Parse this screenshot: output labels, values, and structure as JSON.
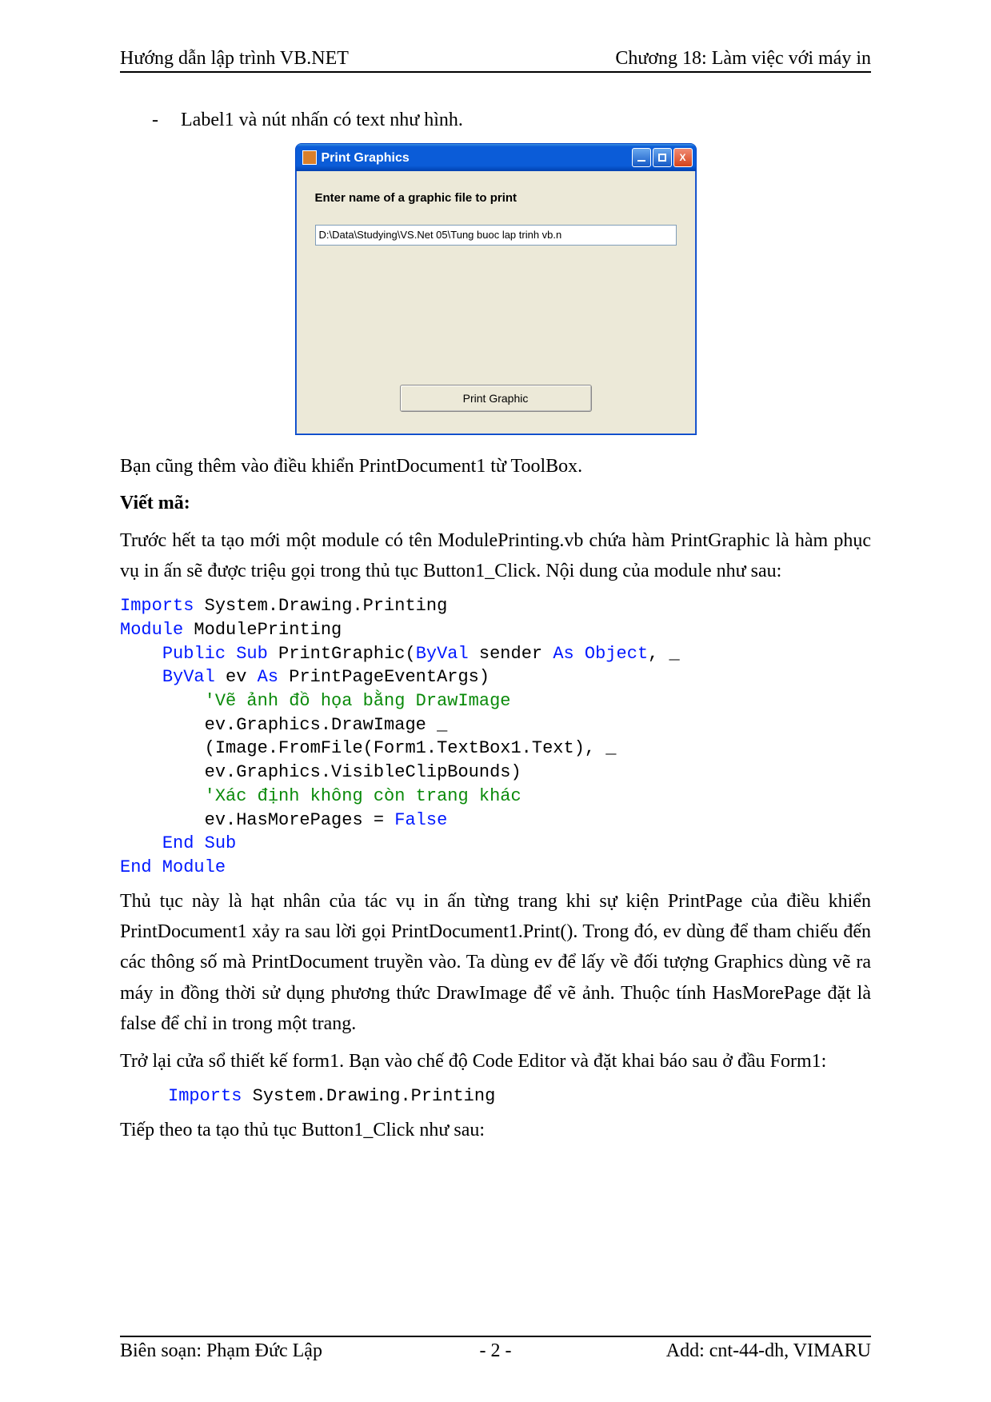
{
  "header": {
    "left": "Hướng dẫn lập trình VB.NET",
    "right": "Chương 18: Làm việc với máy in"
  },
  "bullet1": "Label1 và nút nhấn có text như hình.",
  "xp": {
    "title": "Print Graphics",
    "close": "X",
    "label": "Enter name of  a graphic file to print",
    "input_value": "D:\\Data\\Studying\\VS.Net 05\\Tung buoc lap trinh vb.n",
    "button": "Print Graphic"
  },
  "p1": "Bạn cũng thêm vào điều khiển PrintDocument1 từ ToolBox.",
  "h1": "Viết mã:",
  "p2": "Trước hết ta tạo mới một module có tên ModulePrinting.vb chứa hàm PrintGraphic là hàm phục vụ in ấn sẽ được triệu gọi trong thủ tục Button1_Click. Nội dung của module như sau:",
  "code1": {
    "l1a": "Imports",
    "l1b": " System.Drawing.Printing",
    "l2a": "Module",
    "l2b": " ModulePrinting",
    "l3a": "    ",
    "l3b": "Public Sub",
    "l3c": " PrintGraphic(",
    "l3d": "ByVal",
    "l3e": " sender ",
    "l3f": "As Object",
    "l3g": ", _",
    "l4a": "    ",
    "l4b": "ByVal",
    "l4c": " ev ",
    "l4d": "As",
    "l4e": " PrintPageEventArgs)",
    "l5": "        'Vẽ ảnh đồ họa bằng DrawImage",
    "l6": "        ev.Graphics.DrawImage _",
    "l7": "        (Image.FromFile(Form1.TextBox1.Text), _",
    "l8": "        ev.Graphics.VisibleClipBounds)",
    "l9": "        'Xác định không còn trang khác",
    "l10a": "        ev.HasMorePages = ",
    "l10b": "False",
    "l11a": "    ",
    "l11b": "End Sub",
    "l12": "End Module"
  },
  "p3": "Thủ tục này là hạt nhân của tác vụ in ấn từng trang khi sự kiện PrintPage của điều khiển PrintDocument1 xảy ra sau lời gọi PrintDocument1.Print(). Trong đó, ev dùng để tham chiếu đến các thông số mà PrintDocument truyền vào. Ta dùng ev để lấy về đối tượng Graphics dùng vẽ ra máy in đồng thời sử dụng phương thức DrawImage để vẽ ảnh. Thuộc tính HasMorePage đặt là false để chỉ in trong một trang.",
  "p4": "Trở lại cửa sổ thiết kế form1. Bạn vào chế độ Code Editor và đặt khai báo sau ở đầu Form1:",
  "code2": {
    "a": "Imports",
    "b": " System.Drawing.Printing"
  },
  "p5": "Tiếp theo ta tạo thủ tục Button1_Click như sau:",
  "footer": {
    "left": "Biên soạn: Phạm Đức Lập",
    "center": "- 2 -",
    "right": "Add: cnt-44-dh, VIMARU"
  }
}
